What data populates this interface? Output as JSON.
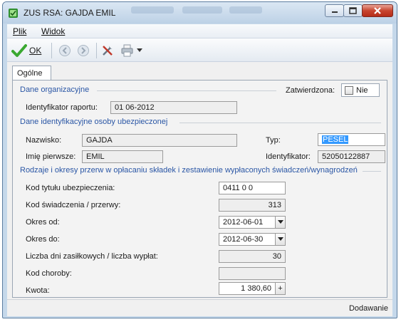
{
  "window": {
    "title": "ZUS RSA: GAJDA EMIL"
  },
  "menu": {
    "items": [
      {
        "label": "Plik"
      },
      {
        "label": "Widok"
      }
    ]
  },
  "toolbar": {
    "ok_label": "OK"
  },
  "tabs": [
    {
      "label": "Ogólne"
    }
  ],
  "org": {
    "heading": "Dane organizacyjne",
    "report_id_label": "Identyfikator raportu:",
    "report_id_value": "01 06-2012",
    "approved_label": "Zatwierdzona:",
    "approved_value": "Nie"
  },
  "person": {
    "heading": "Dane identyfikacyjne osoby ubezpieczonej",
    "surname_label": "Nazwisko:",
    "surname_value": "GAJDA",
    "firstname_label": "Imię pierwsze:",
    "firstname_value": "EMIL",
    "type_label": "Typ:",
    "type_value": "PESEL",
    "id_label": "Identyfikator:",
    "id_value": "52050122887"
  },
  "breaks": {
    "heading": "Rodzaje i okresy przerw w opłacaniu składek i zestawienie wypłaconych świadczeń/wynagrodzeń",
    "insurance_code_label": "Kod tytułu ubezpieczenia:",
    "insurance_code_value": "0411 0 0",
    "benefit_code_label": "Kod świadczenia / przerwy:",
    "benefit_code_value": "313",
    "period_from_label": "Okres od:",
    "period_from_value": "2012-06-01",
    "period_to_label": "Okres do:",
    "period_to_value": "2012-06-30",
    "days_label": "Liczba dni zasiłkowych / liczba wypłat:",
    "days_value": "30",
    "illness_code_label": "Kod choroby:",
    "illness_code_value": "",
    "amount_label": "Kwota:",
    "amount_value": "1 380,60",
    "amount_button": "+"
  },
  "status": {
    "mode": "Dodawanie"
  },
  "colors": {
    "section_heading": "#2a56a5",
    "selection": "#3399ff",
    "ok_check": "#3aa830",
    "close_button": "#c8452f"
  }
}
